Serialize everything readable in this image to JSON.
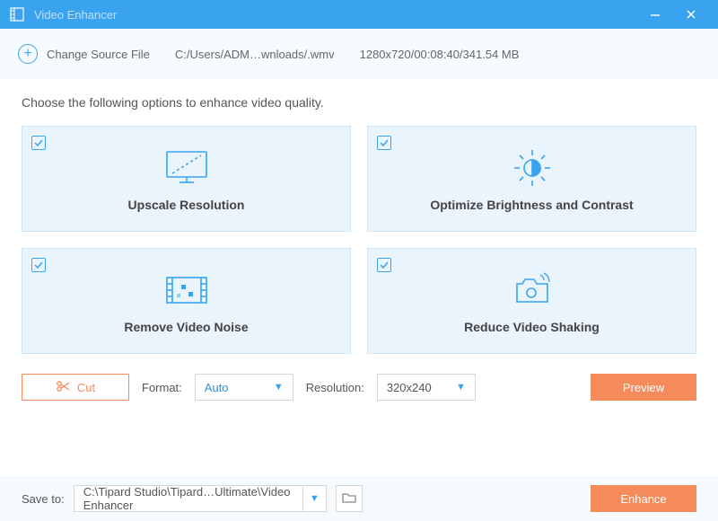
{
  "titlebar": {
    "title": "Video Enhancer"
  },
  "sourcebar": {
    "change_label": "Change Source File",
    "path": "C:/Users/ADM…wnloads/.wmv",
    "info": "1280x720/00:08:40/341.54 MB"
  },
  "content": {
    "instruction": "Choose the following options to enhance video quality."
  },
  "options": {
    "upscale": "Upscale Resolution",
    "brightness": "Optimize Brightness and Contrast",
    "noise": "Remove Video Noise",
    "shake": "Reduce Video Shaking"
  },
  "toolbar": {
    "cut_label": "Cut",
    "format_label": "Format:",
    "format_value": "Auto",
    "resolution_label": "Resolution:",
    "resolution_value": "320x240",
    "preview_label": "Preview"
  },
  "footer": {
    "saveto_label": "Save to:",
    "path": "C:\\Tipard Studio\\Tipard…Ultimate\\Video Enhancer",
    "enhance_label": "Enhance"
  }
}
